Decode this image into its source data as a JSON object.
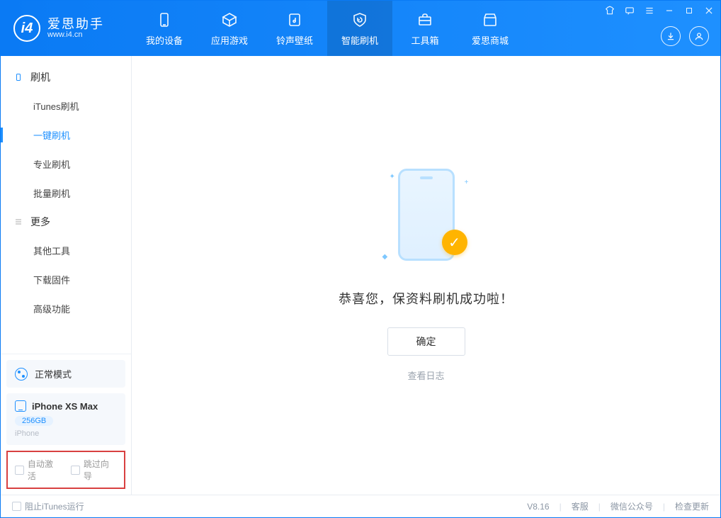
{
  "app": {
    "name": "爱思助手",
    "url": "www.i4.cn"
  },
  "nav": {
    "device": "我的设备",
    "apps": "应用游戏",
    "ringtone": "铃声壁纸",
    "flash": "智能刷机",
    "toolbox": "工具箱",
    "mall": "爱思商城"
  },
  "sidebar": {
    "group_flash": "刷机",
    "items_flash": {
      "itunes": "iTunes刷机",
      "oneclick": "一键刷机",
      "pro": "专业刷机",
      "batch": "批量刷机"
    },
    "group_more": "更多",
    "items_more": {
      "other": "其他工具",
      "firmware": "下载固件",
      "advanced": "高级功能"
    }
  },
  "device": {
    "mode": "正常模式",
    "name": "iPhone XS Max",
    "storage": "256GB",
    "type": "iPhone"
  },
  "checkboxes": {
    "auto_activate": "自动激活",
    "skip_guide": "跳过向导"
  },
  "main": {
    "message": "恭喜您，保资料刷机成功啦！",
    "ok": "确定",
    "log": "查看日志"
  },
  "statusbar": {
    "block_itunes": "阻止iTunes运行",
    "version": "V8.16",
    "support": "客服",
    "wechat": "微信公众号",
    "update": "检查更新"
  }
}
